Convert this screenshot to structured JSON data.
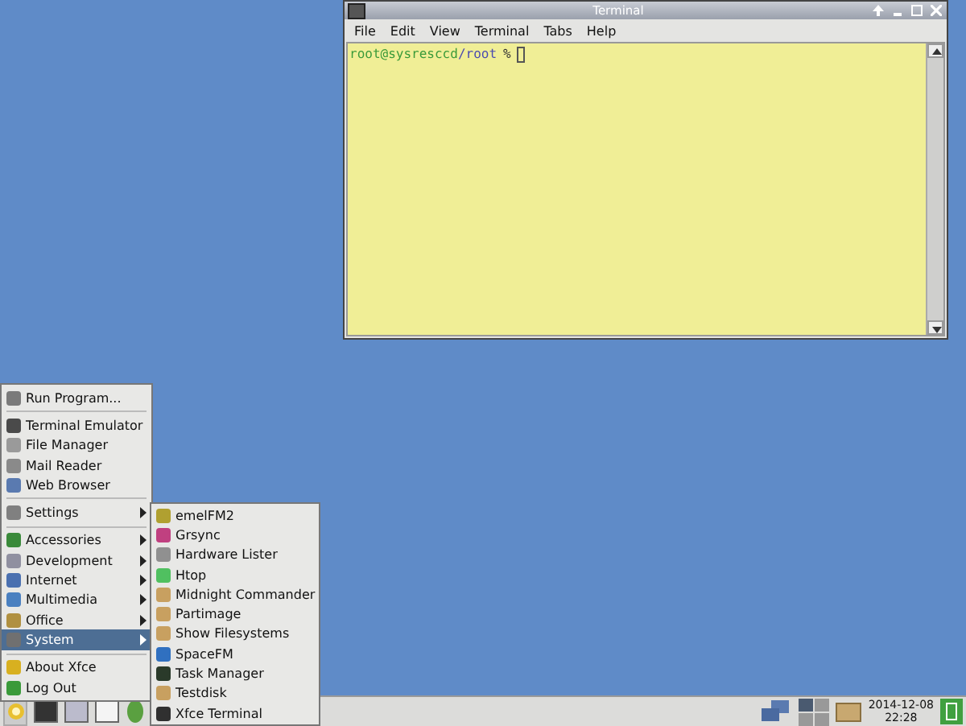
{
  "terminal": {
    "title": "Terminal",
    "menu": [
      "File",
      "Edit",
      "View",
      "Terminal",
      "Tabs",
      "Help"
    ],
    "prompt": {
      "user_host": "root@sysresccd",
      "path": "/root",
      "symbol": "%"
    }
  },
  "main_menu": {
    "groups": [
      [
        {
          "label": "Run Program...",
          "has_submenu": false,
          "selected": false
        }
      ],
      [
        {
          "label": "Terminal Emulator",
          "has_submenu": false,
          "selected": false
        },
        {
          "label": "File Manager",
          "has_submenu": false,
          "selected": false
        },
        {
          "label": "Mail Reader",
          "has_submenu": false,
          "selected": false
        },
        {
          "label": "Web Browser",
          "has_submenu": false,
          "selected": false
        }
      ],
      [
        {
          "label": "Settings",
          "has_submenu": true,
          "selected": false
        }
      ],
      [
        {
          "label": "Accessories",
          "has_submenu": true,
          "selected": false
        },
        {
          "label": "Development",
          "has_submenu": true,
          "selected": false
        },
        {
          "label": "Internet",
          "has_submenu": true,
          "selected": false
        },
        {
          "label": "Multimedia",
          "has_submenu": true,
          "selected": false
        },
        {
          "label": "Office",
          "has_submenu": true,
          "selected": false
        },
        {
          "label": "System",
          "has_submenu": true,
          "selected": true
        }
      ],
      [
        {
          "label": "About Xfce",
          "has_submenu": false,
          "selected": false
        },
        {
          "label": "Log Out",
          "has_submenu": false,
          "selected": false
        }
      ]
    ]
  },
  "submenu": {
    "items": [
      "emelFM2",
      "Grsync",
      "Hardware Lister",
      "Htop",
      "Midnight Commander",
      "Partimage",
      "Show Filesystems",
      "SpaceFM",
      "Task Manager",
      "Testdisk",
      "Xfce Terminal"
    ]
  },
  "taskbar": {
    "date": "2014-12-08",
    "time": "22:28"
  }
}
